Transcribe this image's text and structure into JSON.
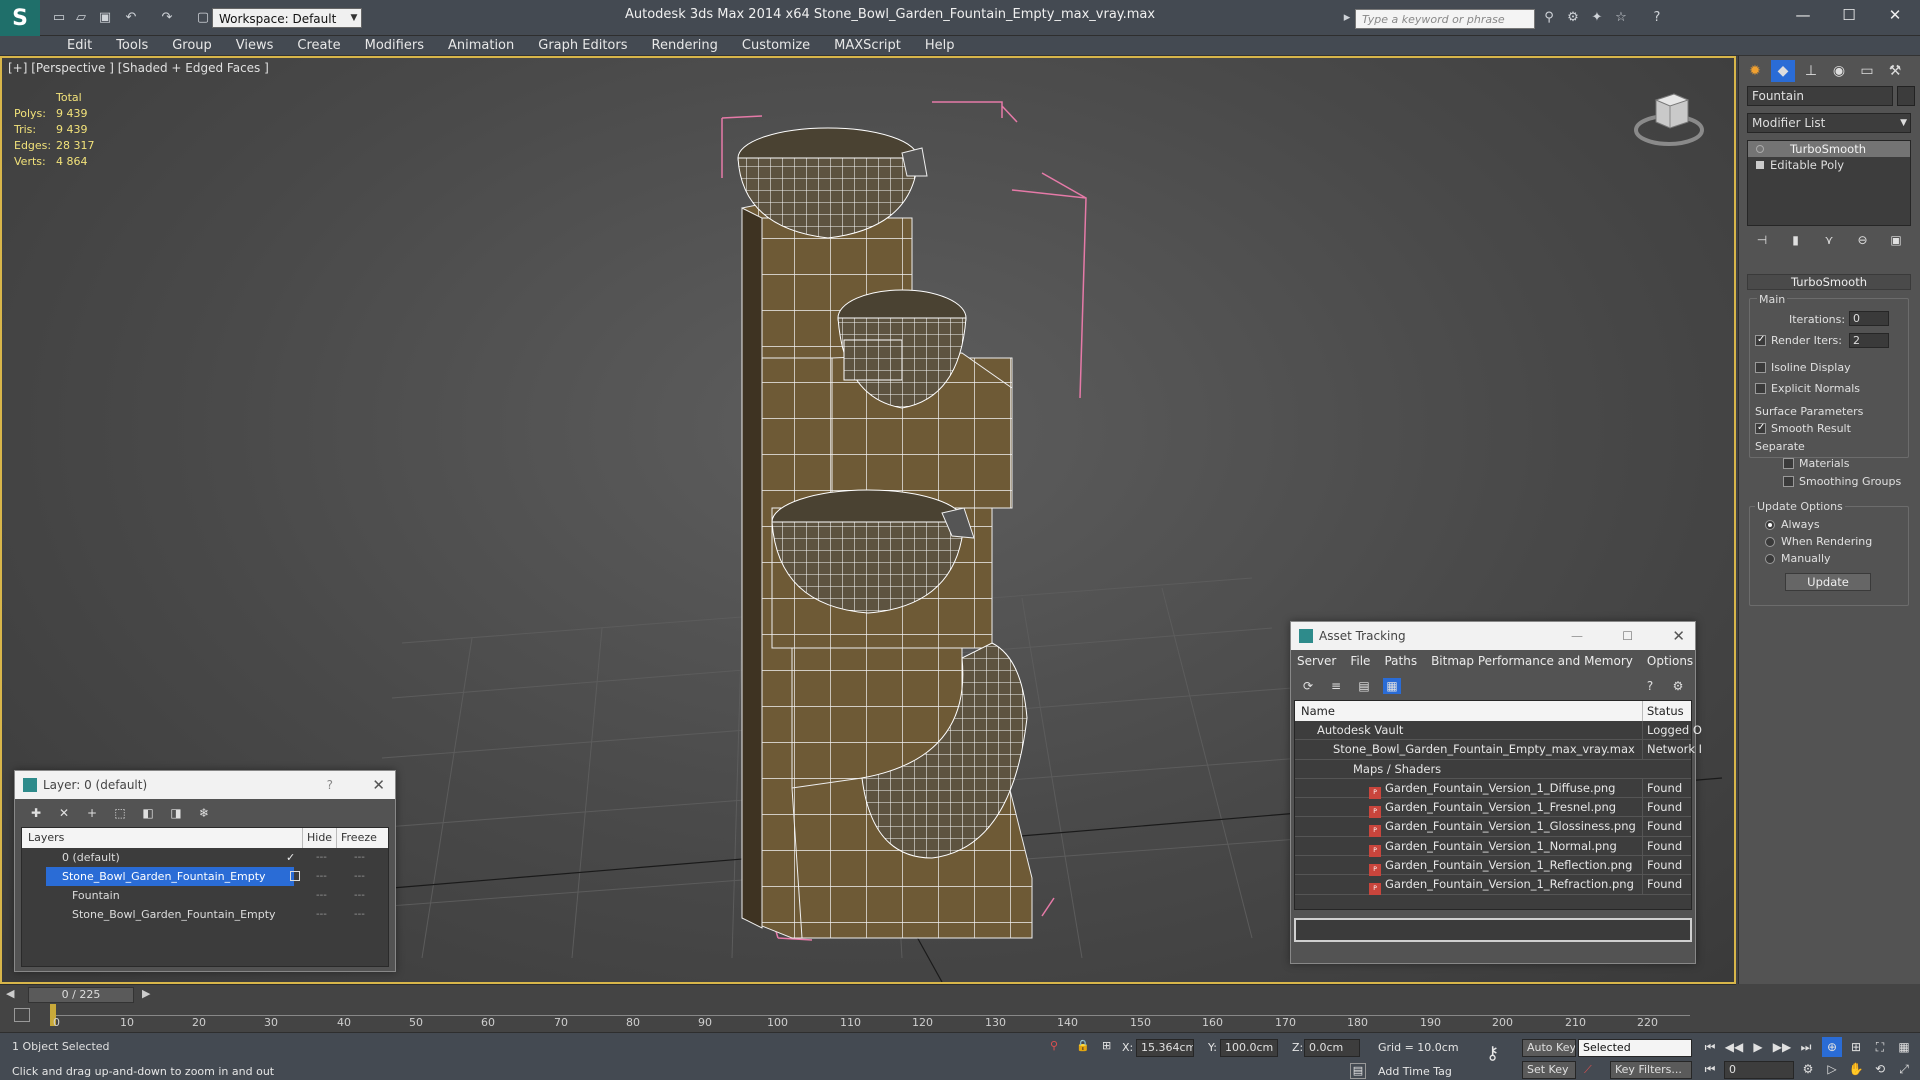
{
  "app": {
    "title": "Autodesk 3ds Max  2014 x64      Stone_Bowl_Garden_Fountain_Empty_max_vray.max",
    "workspace": "Workspace: Default",
    "search_placeholder": "Type a keyword or phrase"
  },
  "menu": [
    "Edit",
    "Tools",
    "Group",
    "Views",
    "Create",
    "Modifiers",
    "Animation",
    "Graph Editors",
    "Rendering",
    "Customize",
    "MAXScript",
    "Help"
  ],
  "viewport": {
    "label": "[+] [Perspective ] [Shaded + Edged Faces ]",
    "stats": {
      "header": "Total",
      "rows": [
        {
          "label": "Polys:",
          "value": "9 439"
        },
        {
          "label": "Tris:",
          "value": "9 439"
        },
        {
          "label": "Edges:",
          "value": "28 317"
        },
        {
          "label": "Verts:",
          "value": "4 864"
        }
      ]
    }
  },
  "layer_panel": {
    "title": "Layer: 0 (default)",
    "help": "?",
    "columns": {
      "name": "Layers",
      "hide": "Hide",
      "freeze": "Freeze"
    },
    "rows": [
      {
        "name": "0 (default)",
        "check": "✓"
      },
      {
        "name": "Stone_Bowl_Garden_Fountain_Empty",
        "check": ""
      },
      {
        "name": "Fountain",
        "check": ""
      },
      {
        "name": "Stone_Bowl_Garden_Fountain_Empty",
        "check": ""
      }
    ]
  },
  "asset_panel": {
    "title": "Asset Tracking",
    "menu": [
      "Server",
      "File",
      "Paths",
      "Bitmap Performance and Memory",
      "Options"
    ],
    "columns": {
      "name": "Name",
      "status": "Status"
    },
    "rows": [
      {
        "name": "Autodesk Vault",
        "status": "Logged O"
      },
      {
        "name": "Stone_Bowl_Garden_Fountain_Empty_max_vray.max",
        "status": "Network I"
      },
      {
        "name": "Maps / Shaders",
        "status": ""
      },
      {
        "name": "Garden_Fountain_Version_1_Diffuse.png",
        "status": "Found"
      },
      {
        "name": "Garden_Fountain_Version_1_Fresnel.png",
        "status": "Found"
      },
      {
        "name": "Garden_Fountain_Version_1_Glossiness.png",
        "status": "Found"
      },
      {
        "name": "Garden_Fountain_Version_1_Normal.png",
        "status": "Found"
      },
      {
        "name": "Garden_Fountain_Version_1_Reflection.png",
        "status": "Found"
      },
      {
        "name": "Garden_Fountain_Version_1_Refraction.png",
        "status": "Found"
      }
    ]
  },
  "command_panel": {
    "object_name": "Fountain",
    "modifier_list": "Modifier List",
    "stack": [
      "TurboSmooth",
      "Editable Poly"
    ],
    "rollout_title": "TurboSmooth",
    "main_label": "Main",
    "iterations_label": "Iterations:",
    "iterations_value": "0",
    "render_iters_label": "Render Iters:",
    "render_iters_value": "2",
    "isoline": "Isoline Display",
    "explicit": "Explicit Normals",
    "surface_label": "Surface Parameters",
    "smooth_result": "Smooth Result",
    "separate_label": "Separate",
    "materials": "Materials",
    "smoothing_groups": "Smoothing Groups",
    "update_label": "Update Options",
    "always": "Always",
    "when_rendering": "When Rendering",
    "manually": "Manually",
    "update_button": "Update"
  },
  "timeline": {
    "frame": "0 / 225",
    "ticks": [
      "0",
      "10",
      "20",
      "30",
      "40",
      "50",
      "60",
      "70",
      "80",
      "90",
      "100",
      "110",
      "120",
      "130",
      "140",
      "150",
      "160",
      "170",
      "180",
      "190",
      "200",
      "210",
      "220"
    ]
  },
  "status": {
    "selection": "1 Object Selected",
    "prompt": "Click and drag up-and-down to zoom in and out",
    "x_label": "X:",
    "x_value": "15.364cm",
    "y_label": "Y:",
    "y_value": "100.0cm",
    "z_label": "Z:",
    "z_value": "0.0cm",
    "grid": "Grid = 10.0cm",
    "auto_key": "Auto Key",
    "selected": "Selected",
    "set_key": "Set Key",
    "key_filters": "Key Filters...",
    "add_time_tag": "Add Time Tag",
    "frame_value": "0"
  }
}
